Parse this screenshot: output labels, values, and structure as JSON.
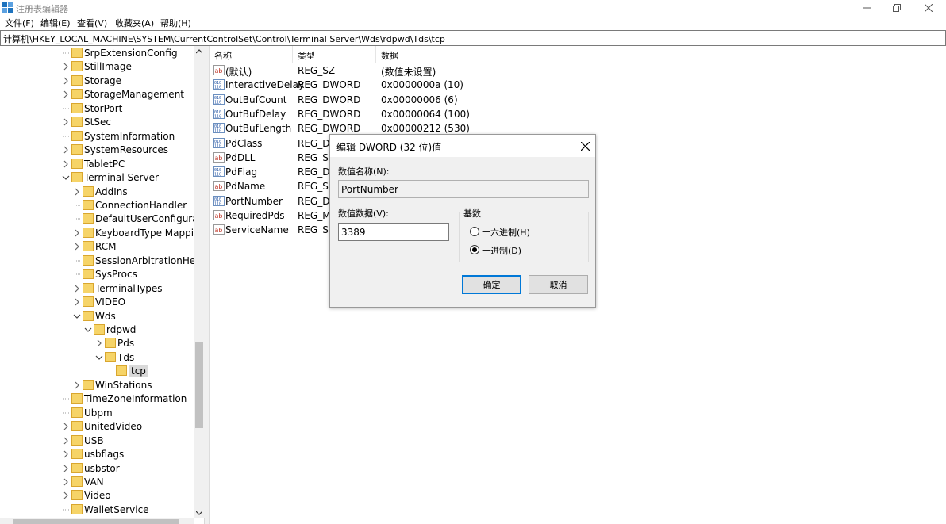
{
  "window": {
    "title": "注册表编辑器"
  },
  "menu": [
    "文件(F)",
    "编辑(E)",
    "查看(V)",
    "收藏夹(A)",
    "帮助(H)"
  ],
  "address": "计算机\\HKEY_LOCAL_MACHINE\\SYSTEM\\CurrentControlSet\\Control\\Terminal Server\\Wds\\rdpwd\\Tds\\tcp",
  "tree": [
    "SrpExtensionConfig",
    "StillImage",
    "Storage",
    "StorageManagement",
    "StorPort",
    "StSec",
    "SystemInformation",
    "SystemResources",
    "TabletPC",
    "Terminal Server",
    "AddIns",
    "ConnectionHandler",
    "DefaultUserConfiguratio",
    "KeyboardType Mapping",
    "RCM",
    "SessionArbitrationHelpe",
    "SysProcs",
    "TerminalTypes",
    "VIDEO",
    "Wds",
    "rdpwd",
    "Pds",
    "Tds",
    "tcp",
    "WinStations",
    "TimeZoneInformation",
    "Ubpm",
    "UnitedVideo",
    "USB",
    "usbflags",
    "usbstor",
    "VAN",
    "Video",
    "WalletService"
  ],
  "columns": {
    "name": "名称",
    "type": "类型",
    "data": "数据"
  },
  "values": [
    {
      "name": "(默认)",
      "type": "REG_SZ",
      "data": "(数值未设置)",
      "icon": "string-value-icon"
    },
    {
      "name": "InteractiveDelay",
      "type": "REG_DWORD",
      "data": "0x0000000a (10)",
      "icon": "binary-value-icon"
    },
    {
      "name": "OutBufCount",
      "type": "REG_DWORD",
      "data": "0x00000006 (6)",
      "icon": "binary-value-icon"
    },
    {
      "name": "OutBufDelay",
      "type": "REG_DWORD",
      "data": "0x00000064 (100)",
      "icon": "binary-value-icon"
    },
    {
      "name": "OutBufLength",
      "type": "REG_DWORD",
      "data": "0x00000212 (530)",
      "icon": "binary-value-icon"
    },
    {
      "name": "PdClass",
      "type": "REG_DW",
      "data": "",
      "icon": "binary-value-icon"
    },
    {
      "name": "PdDLL",
      "type": "REG_SZ",
      "data": "",
      "icon": "string-value-icon"
    },
    {
      "name": "PdFlag",
      "type": "REG_DW",
      "data": "",
      "icon": "binary-value-icon"
    },
    {
      "name": "PdName",
      "type": "REG_SZ",
      "data": "",
      "icon": "string-value-icon"
    },
    {
      "name": "PortNumber",
      "type": "REG_DW",
      "data": "",
      "icon": "binary-value-icon"
    },
    {
      "name": "RequiredPds",
      "type": "REG_MU",
      "data": "",
      "icon": "string-value-icon"
    },
    {
      "name": "ServiceName",
      "type": "REG_SZ",
      "data": "",
      "icon": "string-value-icon"
    }
  ],
  "dialog": {
    "title": "编辑 DWORD (32 位)值",
    "name_label": "数值名称(N):",
    "name_value": "PortNumber",
    "data_label": "数值数据(V):",
    "data_value": "3389",
    "base_label": "基数",
    "hex_label": "十六进制(H)",
    "dec_label": "十进制(D)",
    "base_selected": "dec",
    "ok_label": "确定",
    "cancel_label": "取消"
  },
  "colors": {
    "folder": "#f6d468",
    "accent": "#0078d7",
    "selection": "#d9d9d9"
  }
}
